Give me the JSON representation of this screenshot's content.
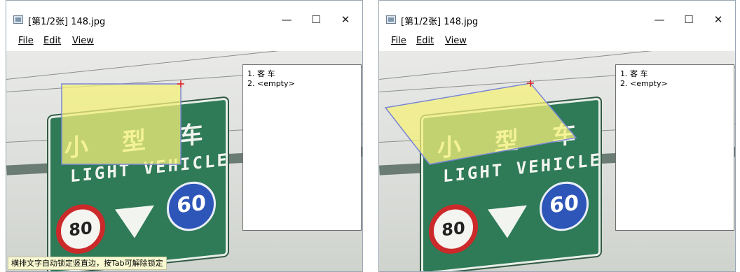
{
  "windows": [
    {
      "title": "[第1/2张] 148.jpg",
      "menu": [
        "File",
        "Edit",
        "View"
      ],
      "window_controls": {
        "minimize": "—",
        "maximize": "☐",
        "close": "✕"
      },
      "labels": [
        "1. 客 车",
        "2. <empty>"
      ],
      "sign": {
        "chinese": "小 型 车",
        "english": "LIGHT VEHICLE",
        "speed_left": "80",
        "speed_right": "60"
      },
      "annotation_shape": "rectangle",
      "status_text": "横排文字自动锁定竖直边，按Tab可解除锁定"
    },
    {
      "title": "[第1/2张] 148.jpg",
      "menu": [
        "File",
        "Edit",
        "View"
      ],
      "window_controls": {
        "minimize": "—",
        "maximize": "☐",
        "close": "✕"
      },
      "labels": [
        "1. 客 车",
        "2. <empty>"
      ],
      "sign": {
        "chinese": "小 型 车",
        "english": "LIGHT VEHICLE",
        "speed_left": "80",
        "speed_right": "60"
      },
      "annotation_shape": "quadrilateral"
    }
  ],
  "colors": {
    "highlight_fill": "#f4f07a",
    "highlight_stroke": "#7b86d6",
    "cursor_cross": "#e01c1c",
    "sign_green": "#2f7a57",
    "status_bg": "#fafad2"
  }
}
